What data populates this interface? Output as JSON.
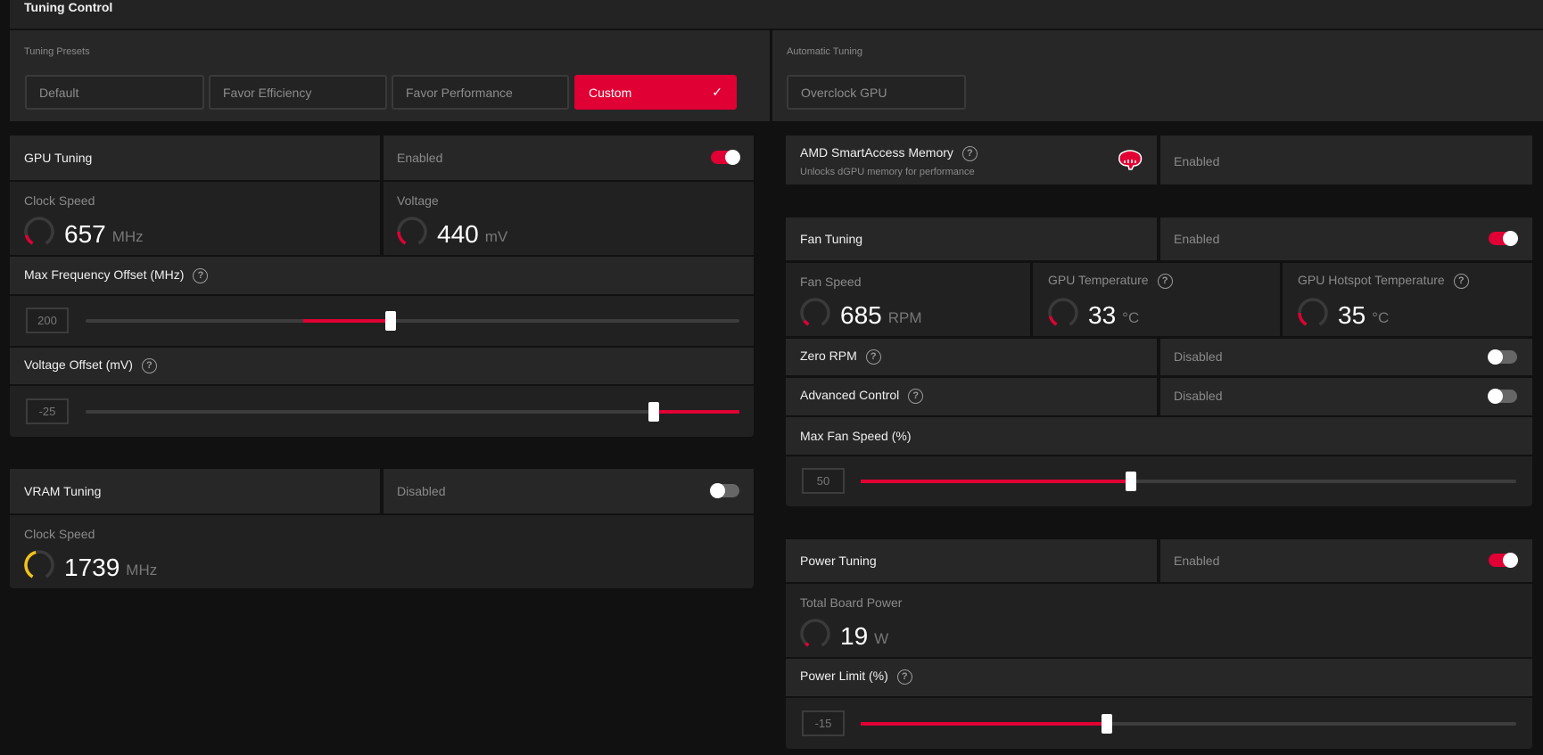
{
  "title": "Tuning Control",
  "presets": {
    "label": "Tuning Presets",
    "options": [
      "Default",
      "Favor Efficiency",
      "Favor Performance",
      "Custom"
    ],
    "selected": "Custom",
    "check_icon": "checkmark-icon"
  },
  "auto_tuning": {
    "label": "Automatic Tuning",
    "button": "Overclock GPU"
  },
  "gpu_tuning": {
    "title": "GPU Tuning",
    "state": "Enabled",
    "enabled": true,
    "clock": {
      "label": "Clock Speed",
      "value": "657",
      "unit": "MHz",
      "gauge": 0.15
    },
    "voltage": {
      "label": "Voltage",
      "value": "440",
      "unit": "mV",
      "gauge": 0.2
    },
    "max_freq": {
      "label": "Max Frequency Offset (MHz)",
      "value": "200",
      "fill_from": 0.333,
      "position": 0.467
    },
    "volt_offset": {
      "label": "Voltage Offset (mV)",
      "value": "-25",
      "fill_from": 0.869,
      "position": 1.0,
      "thumb": 0.869
    }
  },
  "vram_tuning": {
    "title": "VRAM Tuning",
    "state": "Disabled",
    "enabled": false,
    "clock": {
      "label": "Clock Speed",
      "value": "1739",
      "unit": "MHz",
      "gauge": 0.45
    }
  },
  "sam": {
    "title": "AMD SmartAccess Memory",
    "subtitle": "Unlocks dGPU memory for performance",
    "state": "Enabled",
    "icon": "brain-icon"
  },
  "fan_tuning": {
    "title": "Fan Tuning",
    "state": "Enabled",
    "enabled": true,
    "fan_speed": {
      "label": "Fan Speed",
      "value": "685",
      "unit": "RPM",
      "gauge": 0.08
    },
    "gpu_temp": {
      "label": "GPU Temperature",
      "value": "33",
      "unit": "°C",
      "gauge": 0.15
    },
    "hotspot_temp": {
      "label": "GPU Hotspot Temperature",
      "value": "35",
      "unit": "°C",
      "gauge": 0.2
    },
    "zero_rpm": {
      "label": "Zero RPM",
      "state": "Disabled",
      "enabled": false
    },
    "advanced": {
      "label": "Advanced Control",
      "state": "Disabled",
      "enabled": false
    },
    "max_fan": {
      "label": "Max Fan Speed (%)",
      "value": "50",
      "fill_from": 0,
      "position": 0.412
    }
  },
  "power_tuning": {
    "title": "Power Tuning",
    "state": "Enabled",
    "enabled": true,
    "board_power": {
      "label": "Total Board Power",
      "value": "19",
      "unit": "W",
      "gauge": 0.05
    },
    "power_limit": {
      "label": "Power Limit (%)",
      "value": "-15",
      "fill_from": 0,
      "position": 0.376
    }
  },
  "help_glyph": "?",
  "colors": {
    "accent": "#e00034",
    "gauge_yellow": "#f2c21b",
    "gauge_track": "#3a3a3a"
  }
}
